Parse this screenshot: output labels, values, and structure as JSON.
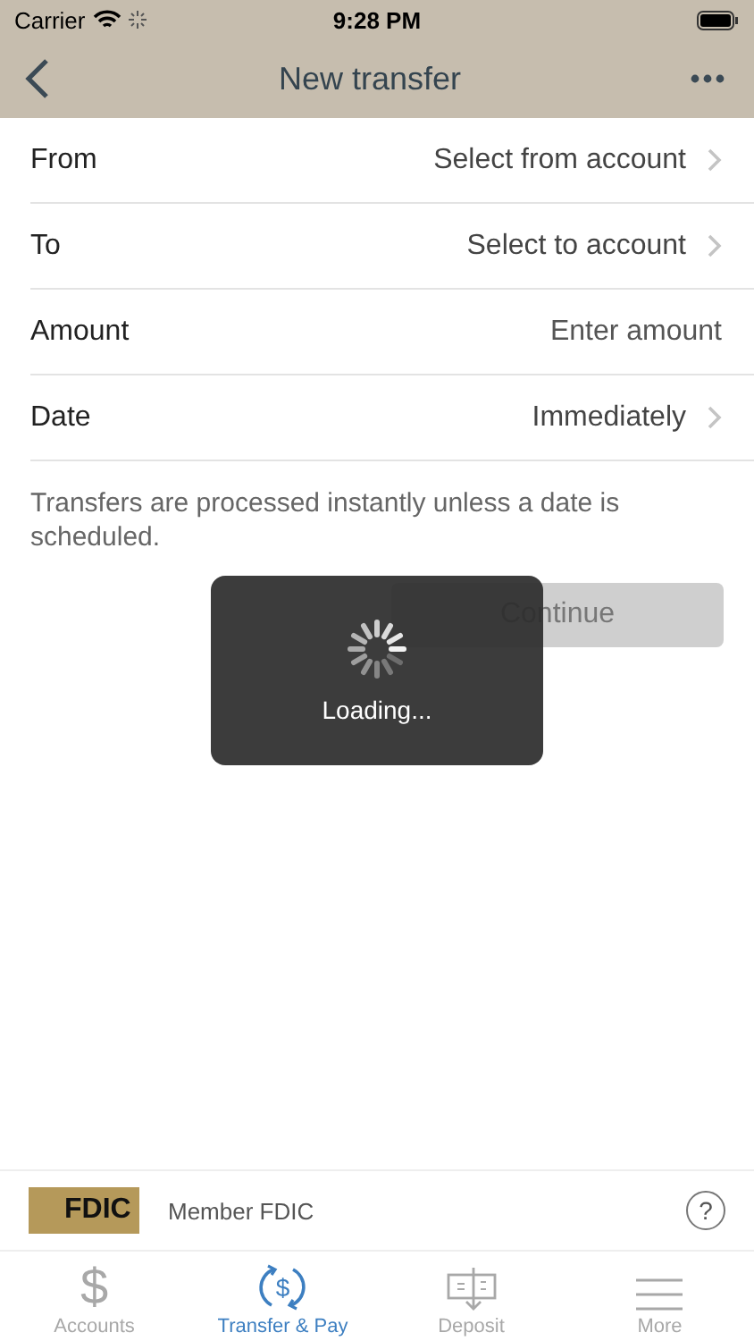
{
  "status_bar": {
    "carrier": "Carrier",
    "time": "9:28 PM"
  },
  "nav": {
    "title": "New transfer"
  },
  "form_rows": [
    {
      "label": "From",
      "value": "Select from account",
      "kind": "select"
    },
    {
      "label": "To",
      "value": "Select to account",
      "kind": "select"
    },
    {
      "label": "Amount",
      "placeholder": "Enter amount",
      "kind": "input"
    },
    {
      "label": "Date",
      "value": "Immediately",
      "kind": "select"
    }
  ],
  "note": "Transfers are processed instantly unless a date is scheduled.",
  "continue_button": {
    "label": "Continue",
    "disabled": true
  },
  "loading": {
    "text": "Loading..."
  },
  "footer": {
    "logo": "FDIC",
    "text": "Member FDIC",
    "help": "?"
  },
  "tab_bar": [
    {
      "label": "Accounts",
      "kind": "dollar",
      "glyph": "$",
      "selected": false
    },
    {
      "label": "Transfer & Pay",
      "kind": "transfer",
      "glyph": "$",
      "selected": true
    },
    {
      "label": "Deposit",
      "kind": "deposit",
      "selected": false
    },
    {
      "label": "More",
      "kind": "more",
      "selected": false
    }
  ]
}
